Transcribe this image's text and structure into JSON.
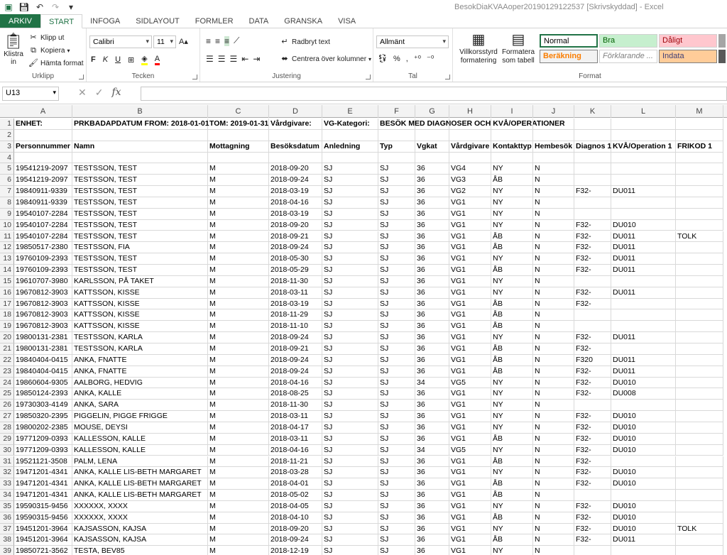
{
  "window": {
    "title": "BesokDiaKVAAoper20190129122537  [Skrivskyddad] - Excel"
  },
  "tabs": [
    "ARKIV",
    "START",
    "INFOGA",
    "SIDLAYOUT",
    "FORMLER",
    "DATA",
    "GRANSKA",
    "VISA"
  ],
  "ribbon": {
    "clipboard": {
      "paste": "Klistra in",
      "cut": "Klipp ut",
      "copy": "Kopiera",
      "format_painter": "Hämta format",
      "name": "Urklipp"
    },
    "font": {
      "name_value": "Calibri",
      "size_value": "11",
      "bold": "F",
      "italic": "K",
      "underline": "U",
      "group_name": "Tecken"
    },
    "alignment": {
      "wrap": "Radbryt text",
      "merge": "Centrera över kolumner",
      "name": "Justering"
    },
    "number": {
      "format_value": "Allmänt",
      "name": "Tal"
    },
    "styles": {
      "conditional": "Villkorsstyrd formatering",
      "table": "Formatera som tabell",
      "name": "Format",
      "cells": [
        {
          "label": "Normal",
          "bg": "#ffffff",
          "fg": "#000000"
        },
        {
          "label": "Bra",
          "bg": "#c6efce",
          "fg": "#006100"
        },
        {
          "label": "Dåligt",
          "bg": "#ffc7ce",
          "fg": "#9c0006"
        },
        {
          "label": "Beräkning",
          "bg": "#f2f2f2",
          "fg": "#fa7d00"
        },
        {
          "label": "Förklarande ...",
          "bg": "#ffffff",
          "fg": "#7f7f7f"
        },
        {
          "label": "Indata",
          "bg": "#ffcc99",
          "fg": "#3f3f76"
        }
      ]
    }
  },
  "formula_bar": {
    "name_box": "U13",
    "value": ""
  },
  "columns": [
    "A",
    "B",
    "C",
    "D",
    "E",
    "F",
    "G",
    "H",
    "I",
    "J",
    "K",
    "L",
    "M"
  ],
  "rows": [
    {
      "n": "1",
      "bold": true,
      "c": [
        "ENHET:",
        "PRKBADAPDATUM FROM: 2018-01-01",
        "TOM: 2019-01-31",
        "Vårdgivare:",
        "VG-Kategori:",
        "BESÖK MED DIAGNOSER OCH KVÅ/OPERATIONER",
        "",
        "",
        "",
        "",
        "",
        "",
        ""
      ]
    },
    {
      "n": "2",
      "c": [
        "",
        "",
        "",
        "",
        "",
        "",
        "",
        "",
        "",
        "",
        "",
        "",
        ""
      ]
    },
    {
      "n": "3",
      "bold": true,
      "c": [
        "Personnummer",
        "Namn",
        "Mottagning",
        "Besöksdatum",
        "Anledning",
        "Typ",
        "Vgkat",
        "Vårdgivare",
        "Kontakttyp",
        "Hembesök",
        "Diagnos 1",
        "KVÅ/Operation 1",
        "FRIKOD     1"
      ]
    },
    {
      "n": "4",
      "c": [
        "",
        "",
        "",
        "",
        "",
        "",
        "",
        "",
        "",
        "",
        "",
        "",
        ""
      ]
    },
    {
      "n": "5",
      "c": [
        "19541219-2097",
        "TESTSSON, TEST",
        "M",
        "2018-09-20",
        "SJ",
        "SJ",
        "36",
        "VG4",
        "NY",
        "N",
        "",
        "",
        ""
      ]
    },
    {
      "n": "6",
      "c": [
        "19541219-2097",
        "TESTSSON, TEST",
        "M",
        "2018-09-24",
        "SJ",
        "SJ",
        "36",
        "VG3",
        "ÅB",
        "N",
        "",
        "",
        ""
      ]
    },
    {
      "n": "7",
      "c": [
        "19840911-9339",
        "TESTSSON, TEST",
        "M",
        "2018-03-19",
        "SJ",
        "SJ",
        "36",
        "VG2",
        "NY",
        "N",
        "F32-",
        "DU011",
        ""
      ]
    },
    {
      "n": "8",
      "c": [
        "19840911-9339",
        "TESTSSON, TEST",
        "M",
        "2018-04-16",
        "SJ",
        "SJ",
        "36",
        "VG1",
        "NY",
        "N",
        "",
        "",
        ""
      ]
    },
    {
      "n": "9",
      "c": [
        "19540107-2284",
        "TESTSSON, TEST",
        "M",
        "2018-03-19",
        "SJ",
        "SJ",
        "36",
        "VG1",
        "NY",
        "N",
        "",
        "",
        ""
      ]
    },
    {
      "n": "10",
      "c": [
        "19540107-2284",
        "TESTSSON, TEST",
        "M",
        "2018-09-20",
        "SJ",
        "SJ",
        "36",
        "VG1",
        "NY",
        "N",
        "F32-",
        "DU010",
        ""
      ]
    },
    {
      "n": "11",
      "c": [
        "19540107-2284",
        "TESTSSON, TEST",
        "M",
        "2018-09-21",
        "SJ",
        "SJ",
        "36",
        "VG1",
        "ÅB",
        "N",
        "F32-",
        "DU011",
        "TOLK"
      ]
    },
    {
      "n": "12",
      "c": [
        "19850517-2380",
        "TESTSSON, FIA",
        "M",
        "2018-09-24",
        "SJ",
        "SJ",
        "36",
        "VG1",
        "ÅB",
        "N",
        "F32-",
        "DU011",
        ""
      ]
    },
    {
      "n": "13",
      "c": [
        "19760109-2393",
        "TESTSSON, TEST",
        "M",
        "2018-05-30",
        "SJ",
        "SJ",
        "36",
        "VG1",
        "NY",
        "N",
        "F32-",
        "DU011",
        ""
      ]
    },
    {
      "n": "14",
      "c": [
        "19760109-2393",
        "TESTSSON, TEST",
        "M",
        "2018-05-29",
        "SJ",
        "SJ",
        "36",
        "VG1",
        "ÅB",
        "N",
        "F32-",
        "DU011",
        ""
      ]
    },
    {
      "n": "15",
      "c": [
        "19610707-3980",
        "KARLSSON, PÅ TAKET",
        "M",
        "2018-11-30",
        "SJ",
        "SJ",
        "36",
        "VG1",
        "NY",
        "N",
        "",
        "",
        ""
      ]
    },
    {
      "n": "16",
      "c": [
        "19670812-3903",
        "KATTSSON, KISSE",
        "M",
        "2018-03-11",
        "SJ",
        "SJ",
        "36",
        "VG1",
        "NY",
        "N",
        "F32-",
        "DU011",
        ""
      ]
    },
    {
      "n": "17",
      "c": [
        "19670812-3903",
        "KATTSSON, KISSE",
        "M",
        "2018-03-19",
        "SJ",
        "SJ",
        "36",
        "VG1",
        "ÅB",
        "N",
        "F32-",
        "",
        ""
      ]
    },
    {
      "n": "18",
      "c": [
        "19670812-3903",
        "KATTSSON, KISSE",
        "M",
        "2018-11-29",
        "SJ",
        "SJ",
        "36",
        "VG1",
        "ÅB",
        "N",
        "",
        "",
        ""
      ]
    },
    {
      "n": "19",
      "c": [
        "19670812-3903",
        "KATTSSON, KISSE",
        "M",
        "2018-11-10",
        "SJ",
        "SJ",
        "36",
        "VG1",
        "ÅB",
        "N",
        "",
        "",
        ""
      ]
    },
    {
      "n": "20",
      "c": [
        "19800131-2381",
        "TESTSSON, KARLA",
        "M",
        "2018-09-24",
        "SJ",
        "SJ",
        "36",
        "VG1",
        "NY",
        "N",
        "F32-",
        "DU011",
        ""
      ]
    },
    {
      "n": "21",
      "c": [
        "19800131-2381",
        "TESTSSON, KARLA",
        "M",
        "2018-09-21",
        "SJ",
        "SJ",
        "36",
        "VG1",
        "ÅB",
        "N",
        "F32-",
        "",
        ""
      ]
    },
    {
      "n": "22",
      "c": [
        "19840404-0415",
        "ANKA, FNATTE",
        "M",
        "2018-09-24",
        "SJ",
        "SJ",
        "36",
        "VG1",
        "ÅB",
        "N",
        "F320",
        "DU011",
        ""
      ]
    },
    {
      "n": "23",
      "c": [
        "19840404-0415",
        "ANKA, FNATTE",
        "M",
        "2018-09-24",
        "SJ",
        "SJ",
        "36",
        "VG1",
        "ÅB",
        "N",
        "F32-",
        "DU011",
        ""
      ]
    },
    {
      "n": "24",
      "c": [
        "19860604-9305",
        "AALBORG, HEDVIG",
        "M",
        "2018-04-16",
        "SJ",
        "SJ",
        "34",
        "VG5",
        "NY",
        "N",
        "F32-",
        "DU010",
        ""
      ]
    },
    {
      "n": "25",
      "c": [
        "19850124-2393",
        "ANKA, KALLE",
        "M",
        "2018-08-25",
        "SJ",
        "SJ",
        "36",
        "VG1",
        "NY",
        "N",
        "F32-",
        "DU008",
        ""
      ]
    },
    {
      "n": "26",
      "c": [
        "19730303-4149",
        "ANKA, SARA",
        "M",
        "2018-11-30",
        "SJ",
        "SJ",
        "36",
        "VG1",
        "NY",
        "N",
        "",
        "",
        ""
      ]
    },
    {
      "n": "27",
      "c": [
        "19850320-2395",
        "PIGGELIN, PIGGE FRIGGE",
        "M",
        "2018-03-11",
        "SJ",
        "SJ",
        "36",
        "VG1",
        "NY",
        "N",
        "F32-",
        "DU010",
        ""
      ]
    },
    {
      "n": "28",
      "c": [
        "19800202-2385",
        "MOUSE, DEYSI",
        "M",
        "2018-04-17",
        "SJ",
        "SJ",
        "36",
        "VG1",
        "NY",
        "N",
        "F32-",
        "DU010",
        ""
      ]
    },
    {
      "n": "29",
      "c": [
        "19771209-0393",
        "KALLESSON, KALLE",
        "M",
        "2018-03-11",
        "SJ",
        "SJ",
        "36",
        "VG1",
        "ÅB",
        "N",
        "F32-",
        "DU010",
        ""
      ]
    },
    {
      "n": "30",
      "c": [
        "19771209-0393",
        "KALLESSON, KALLE",
        "M",
        "2018-04-16",
        "SJ",
        "SJ",
        "34",
        "VG5",
        "NY",
        "N",
        "F32-",
        "DU010",
        ""
      ]
    },
    {
      "n": "31",
      "c": [
        "19521121-3508",
        "PALM, LENA",
        "M",
        "2018-11-21",
        "SJ",
        "SJ",
        "36",
        "VG1",
        "ÅB",
        "N",
        "F32-",
        "",
        ""
      ]
    },
    {
      "n": "32",
      "c": [
        "19471201-4341",
        "ANKA, KALLE LIS-BETH MARGARET",
        "M",
        "2018-03-28",
        "SJ",
        "SJ",
        "36",
        "VG1",
        "NY",
        "N",
        "F32-",
        "DU010",
        ""
      ]
    },
    {
      "n": "33",
      "c": [
        "19471201-4341",
        "ANKA, KALLE LIS-BETH MARGARET",
        "M",
        "2018-04-01",
        "SJ",
        "SJ",
        "36",
        "VG1",
        "ÅB",
        "N",
        "F32-",
        "DU010",
        ""
      ]
    },
    {
      "n": "34",
      "c": [
        "19471201-4341",
        "ANKA, KALLE LIS-BETH MARGARET",
        "M",
        "2018-05-02",
        "SJ",
        "SJ",
        "36",
        "VG1",
        "ÅB",
        "N",
        "",
        "",
        ""
      ]
    },
    {
      "n": "35",
      "c": [
        "19590315-9456",
        "XXXXXX, XXXX",
        "M",
        "2018-04-05",
        "SJ",
        "SJ",
        "36",
        "VG1",
        "NY",
        "N",
        "F32-",
        "DU010",
        ""
      ]
    },
    {
      "n": "36",
      "c": [
        "19590315-9456",
        "XXXXXX, XXXX",
        "M",
        "2018-04-10",
        "SJ",
        "SJ",
        "36",
        "VG1",
        "ÅB",
        "N",
        "F32-",
        "DU010",
        ""
      ]
    },
    {
      "n": "37",
      "c": [
        "19451201-3964",
        "KAJSASSON, KAJSA",
        "M",
        "2018-09-20",
        "SJ",
        "SJ",
        "36",
        "VG1",
        "NY",
        "N",
        "F32-",
        "DU010",
        "TOLK"
      ]
    },
    {
      "n": "38",
      "c": [
        "19451201-3964",
        "KAJSASSON, KAJSA",
        "M",
        "2018-09-24",
        "SJ",
        "SJ",
        "36",
        "VG1",
        "ÅB",
        "N",
        "F32-",
        "DU011",
        ""
      ]
    },
    {
      "n": "39",
      "c": [
        "19850721-3562",
        "TESTA, BEV85",
        "M",
        "2018-12-19",
        "SJ",
        "SJ",
        "36",
        "VG1",
        "NY",
        "N",
        "",
        "",
        ""
      ]
    }
  ]
}
